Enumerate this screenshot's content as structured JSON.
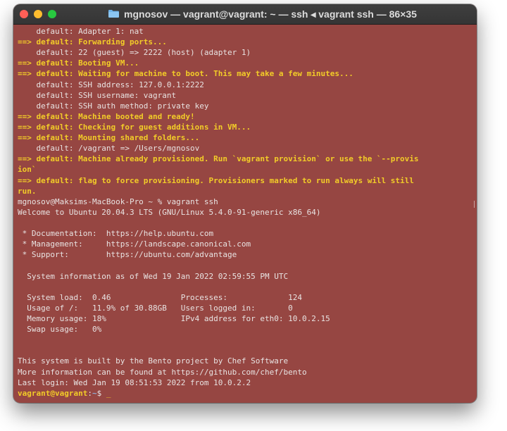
{
  "window": {
    "title": "mgnosov — vagrant@vagrant: ~ — ssh ◂ vagrant ssh — 86×35",
    "colors": {
      "background": "#964642",
      "highlight": "#f2cc28",
      "text": "#e8e3e2"
    }
  },
  "terminal": {
    "lines": [
      {
        "text": "    default: Adapter 1: nat",
        "style": "normal"
      },
      {
        "text": "==> default: Forwarding ports...",
        "style": "highlight"
      },
      {
        "text": "    default: 22 (guest) => 2222 (host) (adapter 1)",
        "style": "normal"
      },
      {
        "text": "==> default: Booting VM...",
        "style": "highlight"
      },
      {
        "text": "==> default: Waiting for machine to boot. This may take a few minutes...",
        "style": "highlight"
      },
      {
        "text": "    default: SSH address: 127.0.0.1:2222",
        "style": "normal"
      },
      {
        "text": "    default: SSH username: vagrant",
        "style": "normal"
      },
      {
        "text": "    default: SSH auth method: private key",
        "style": "normal"
      },
      {
        "text": "==> default: Machine booted and ready!",
        "style": "highlight"
      },
      {
        "text": "==> default: Checking for guest additions in VM...",
        "style": "highlight"
      },
      {
        "text": "==> default: Mounting shared folders...",
        "style": "highlight"
      },
      {
        "text": "    default: /vagrant => /Users/mgnosov",
        "style": "normal"
      },
      {
        "text": "==> default: Machine already provisioned. Run `vagrant provision` or use the `--provis",
        "style": "highlight"
      },
      {
        "text": "ion`",
        "style": "highlight"
      },
      {
        "text": "==> default: flag to force provisioning. Provisioners marked to run always will still",
        "style": "highlight"
      },
      {
        "text": "run.",
        "style": "highlight"
      },
      {
        "text": "mgnosov@Maksims-MacBook-Pro ~ % vagrant ssh",
        "style": "normal"
      },
      {
        "text": "Welcome to Ubuntu 20.04.3 LTS (GNU/Linux 5.4.0-91-generic x86_64)",
        "style": "normal"
      },
      {
        "text": "",
        "style": "normal"
      },
      {
        "text": " * Documentation:  https://help.ubuntu.com",
        "style": "normal"
      },
      {
        "text": " * Management:     https://landscape.canonical.com",
        "style": "normal"
      },
      {
        "text": " * Support:        https://ubuntu.com/advantage",
        "style": "normal"
      },
      {
        "text": "",
        "style": "normal"
      },
      {
        "text": "  System information as of Wed 19 Jan 2022 02:59:55 PM UTC",
        "style": "normal"
      },
      {
        "text": "",
        "style": "normal"
      },
      {
        "text": "  System load:  0.46               Processes:             124",
        "style": "normal"
      },
      {
        "text": "  Usage of /:   11.9% of 30.88GB   Users logged in:       0",
        "style": "normal"
      },
      {
        "text": "  Memory usage: 18%                IPv4 address for eth0: 10.0.2.15",
        "style": "normal"
      },
      {
        "text": "  Swap usage:   0%",
        "style": "normal"
      },
      {
        "text": "",
        "style": "normal"
      },
      {
        "text": "",
        "style": "normal"
      },
      {
        "text": "This system is built by the Bento project by Chef Software",
        "style": "normal"
      },
      {
        "text": "More information can be found at https://github.com/chef/bento",
        "style": "normal"
      },
      {
        "text": "Last login: Wed Jan 19 08:51:53 2022 from 10.0.2.2",
        "style": "normal"
      }
    ],
    "prompt": {
      "user": "vagrant@vagrant",
      "sep": ":",
      "path": "~",
      "symbol": "$ ",
      "cursor": "_"
    }
  }
}
